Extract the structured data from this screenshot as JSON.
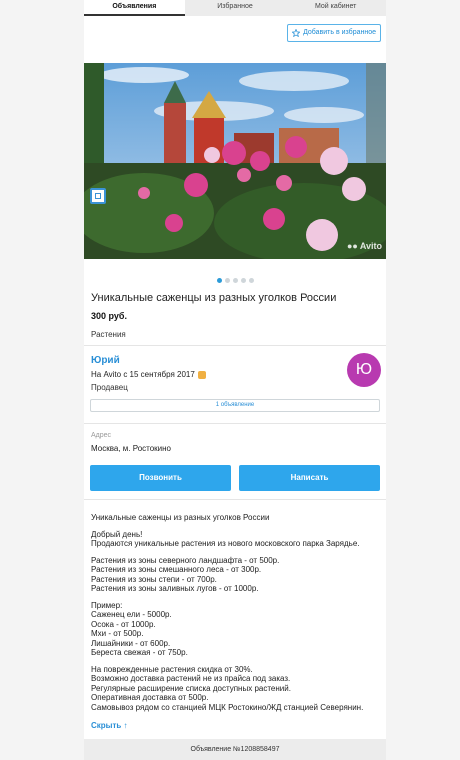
{
  "tabs": [
    {
      "label": "Объявления",
      "active": true
    },
    {
      "label": "Избранное",
      "active": false
    },
    {
      "label": "Мой кабинет",
      "active": false
    }
  ],
  "favorite_button": {
    "label": "Добавить в избранное",
    "icon": "star-icon"
  },
  "photo": {
    "watermark": "Avito",
    "slide_count": 5,
    "active_slide": 1
  },
  "listing": {
    "title": "Уникальные саженцы из разных уголков России",
    "price": "300 руб.",
    "category": "Растения"
  },
  "seller": {
    "name": "Юрий",
    "since": "На Avito с 15 сентября 2017",
    "role": "Продавец",
    "avatar_letter": "Ю",
    "avatar_color": "#b83ab0",
    "ads_count_link": "1 объявление"
  },
  "address": {
    "label": "Адрес",
    "value": "Москва, м. Ростокино"
  },
  "actions": {
    "call": "Позвонить",
    "write": "Написать"
  },
  "description": {
    "paragraphs": [
      [
        "Уникальные саженцы из разных уголков России"
      ],
      [
        "Добрый день!",
        "Продаются уникальные растения из нового московского парка Зарядье."
      ],
      [
        "Растения из зоны северного ландшафта - от 500р.",
        "Растения из зоны смешанного леса - от 300р.",
        "Растения из зоны степи - от 700р.",
        "Растения из зоны заливных лугов - от 1000р."
      ],
      [
        "Пример:",
        "Саженец ели - 5000р.",
        "Осока - от 1000р.",
        "Мхи - от 500р.",
        "Лишайники - от 600р.",
        "Береста свежая - от 750р."
      ],
      [
        "На поврежденные растения скидка от 30%.",
        "Возможно доставка растений не из прайса под заказ.",
        "Регулярные расширение списка доступных растений.",
        "Оперативная доставка от 500р.",
        "Самовывоз рядом со станцией МЦК Ростокино/ЖД станцией Северянин."
      ]
    ]
  },
  "hide_link": "Скрыть ↑",
  "footer": "Объявление №1208858497",
  "colors": {
    "accent": "#2ea6ec",
    "link": "#2a8fd6"
  }
}
